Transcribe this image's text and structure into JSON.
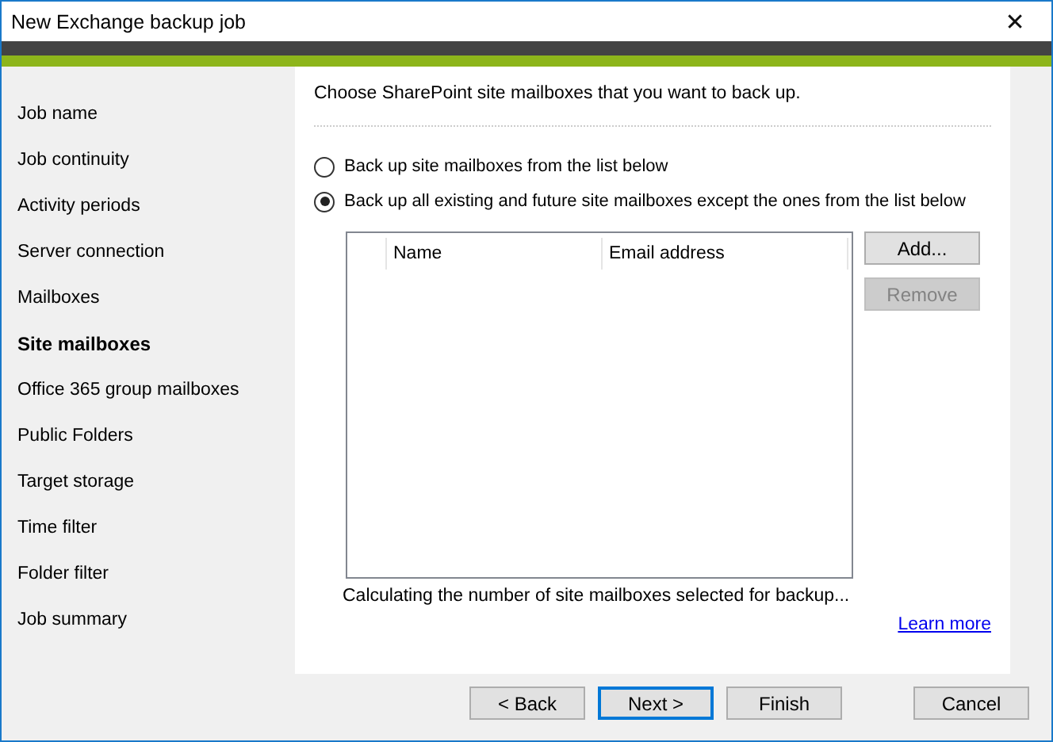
{
  "window": {
    "title": "New Exchange backup job",
    "close": "✕"
  },
  "sidebar": {
    "items": [
      {
        "label": "Job name",
        "selected": false
      },
      {
        "label": "Job continuity",
        "selected": false
      },
      {
        "label": "Activity periods",
        "selected": false
      },
      {
        "label": "Server connection",
        "selected": false
      },
      {
        "label": "Mailboxes",
        "selected": false
      },
      {
        "label": "Site mailboxes",
        "selected": true
      },
      {
        "label": "Office 365 group mailboxes",
        "selected": false
      },
      {
        "label": "Public Folders",
        "selected": false
      },
      {
        "label": "Target storage",
        "selected": false
      },
      {
        "label": "Time filter",
        "selected": false
      },
      {
        "label": "Folder filter",
        "selected": false
      },
      {
        "label": "Job summary",
        "selected": false
      }
    ]
  },
  "heading": "Choose SharePoint site mailboxes that you want to back up.",
  "options": [
    {
      "label": "Back up site mailboxes from the list below",
      "selected": false
    },
    {
      "label": "Back up all existing and future site mailboxes except the ones from the list below",
      "selected": true
    }
  ],
  "table": {
    "columns": [
      "Name",
      "Email address"
    ]
  },
  "list_buttons": [
    {
      "label": "Add...",
      "disabled": false
    },
    {
      "label": "Remove",
      "disabled": true
    }
  ],
  "status": "Calculating the number of site mailboxes selected for backup...",
  "link": "Learn more",
  "footer_buttons": [
    {
      "label": "< Back",
      "default": false
    },
    {
      "label": "Next >",
      "default": true
    },
    {
      "label": "Finish",
      "default": false
    },
    {
      "label": "Cancel",
      "default": false
    }
  ]
}
